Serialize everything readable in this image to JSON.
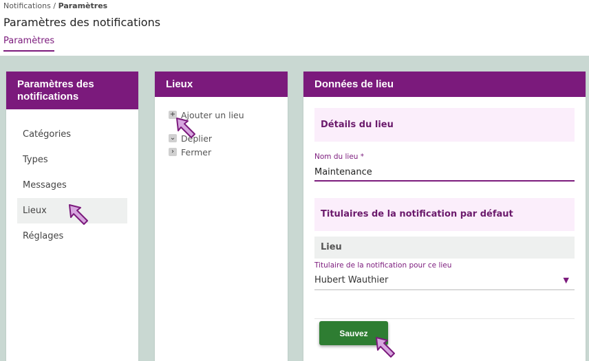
{
  "breadcrumb": {
    "root": "Notifications",
    "separator": " / ",
    "current": "Paramètres"
  },
  "page": {
    "title": "Paramètres des notifications",
    "tab": "Paramètres"
  },
  "panel_settings": {
    "title": "Paramètres des notifications",
    "items": [
      {
        "label": "Catégories",
        "active": false
      },
      {
        "label": "Types",
        "active": false
      },
      {
        "label": "Messages",
        "active": false
      },
      {
        "label": "Lieux",
        "active": true
      },
      {
        "label": "Réglages",
        "active": false
      }
    ]
  },
  "panel_places": {
    "title": "Lieux",
    "add_label": "Ajouter un lieu",
    "expand_label": "Déplier",
    "collapse_label": "Fermer"
  },
  "panel_place_data": {
    "title": "Données de lieu",
    "details_heading": "Détails du lieu",
    "name_label": "Nom du lieu *",
    "name_value": "Maintenance",
    "holders_heading": "Titulaires de la notification par défaut",
    "place_row_label": "Lieu",
    "holder_label": "Titulaire de la notification pour ce lieu",
    "holder_value": "Hubert Wauthier",
    "save_label": "Sauvez"
  },
  "colors": {
    "accent": "#7b1a7c",
    "workspace_bg": "#c9d8d2",
    "save_button": "#2e7d32",
    "section_bg": "#fbeefb"
  }
}
